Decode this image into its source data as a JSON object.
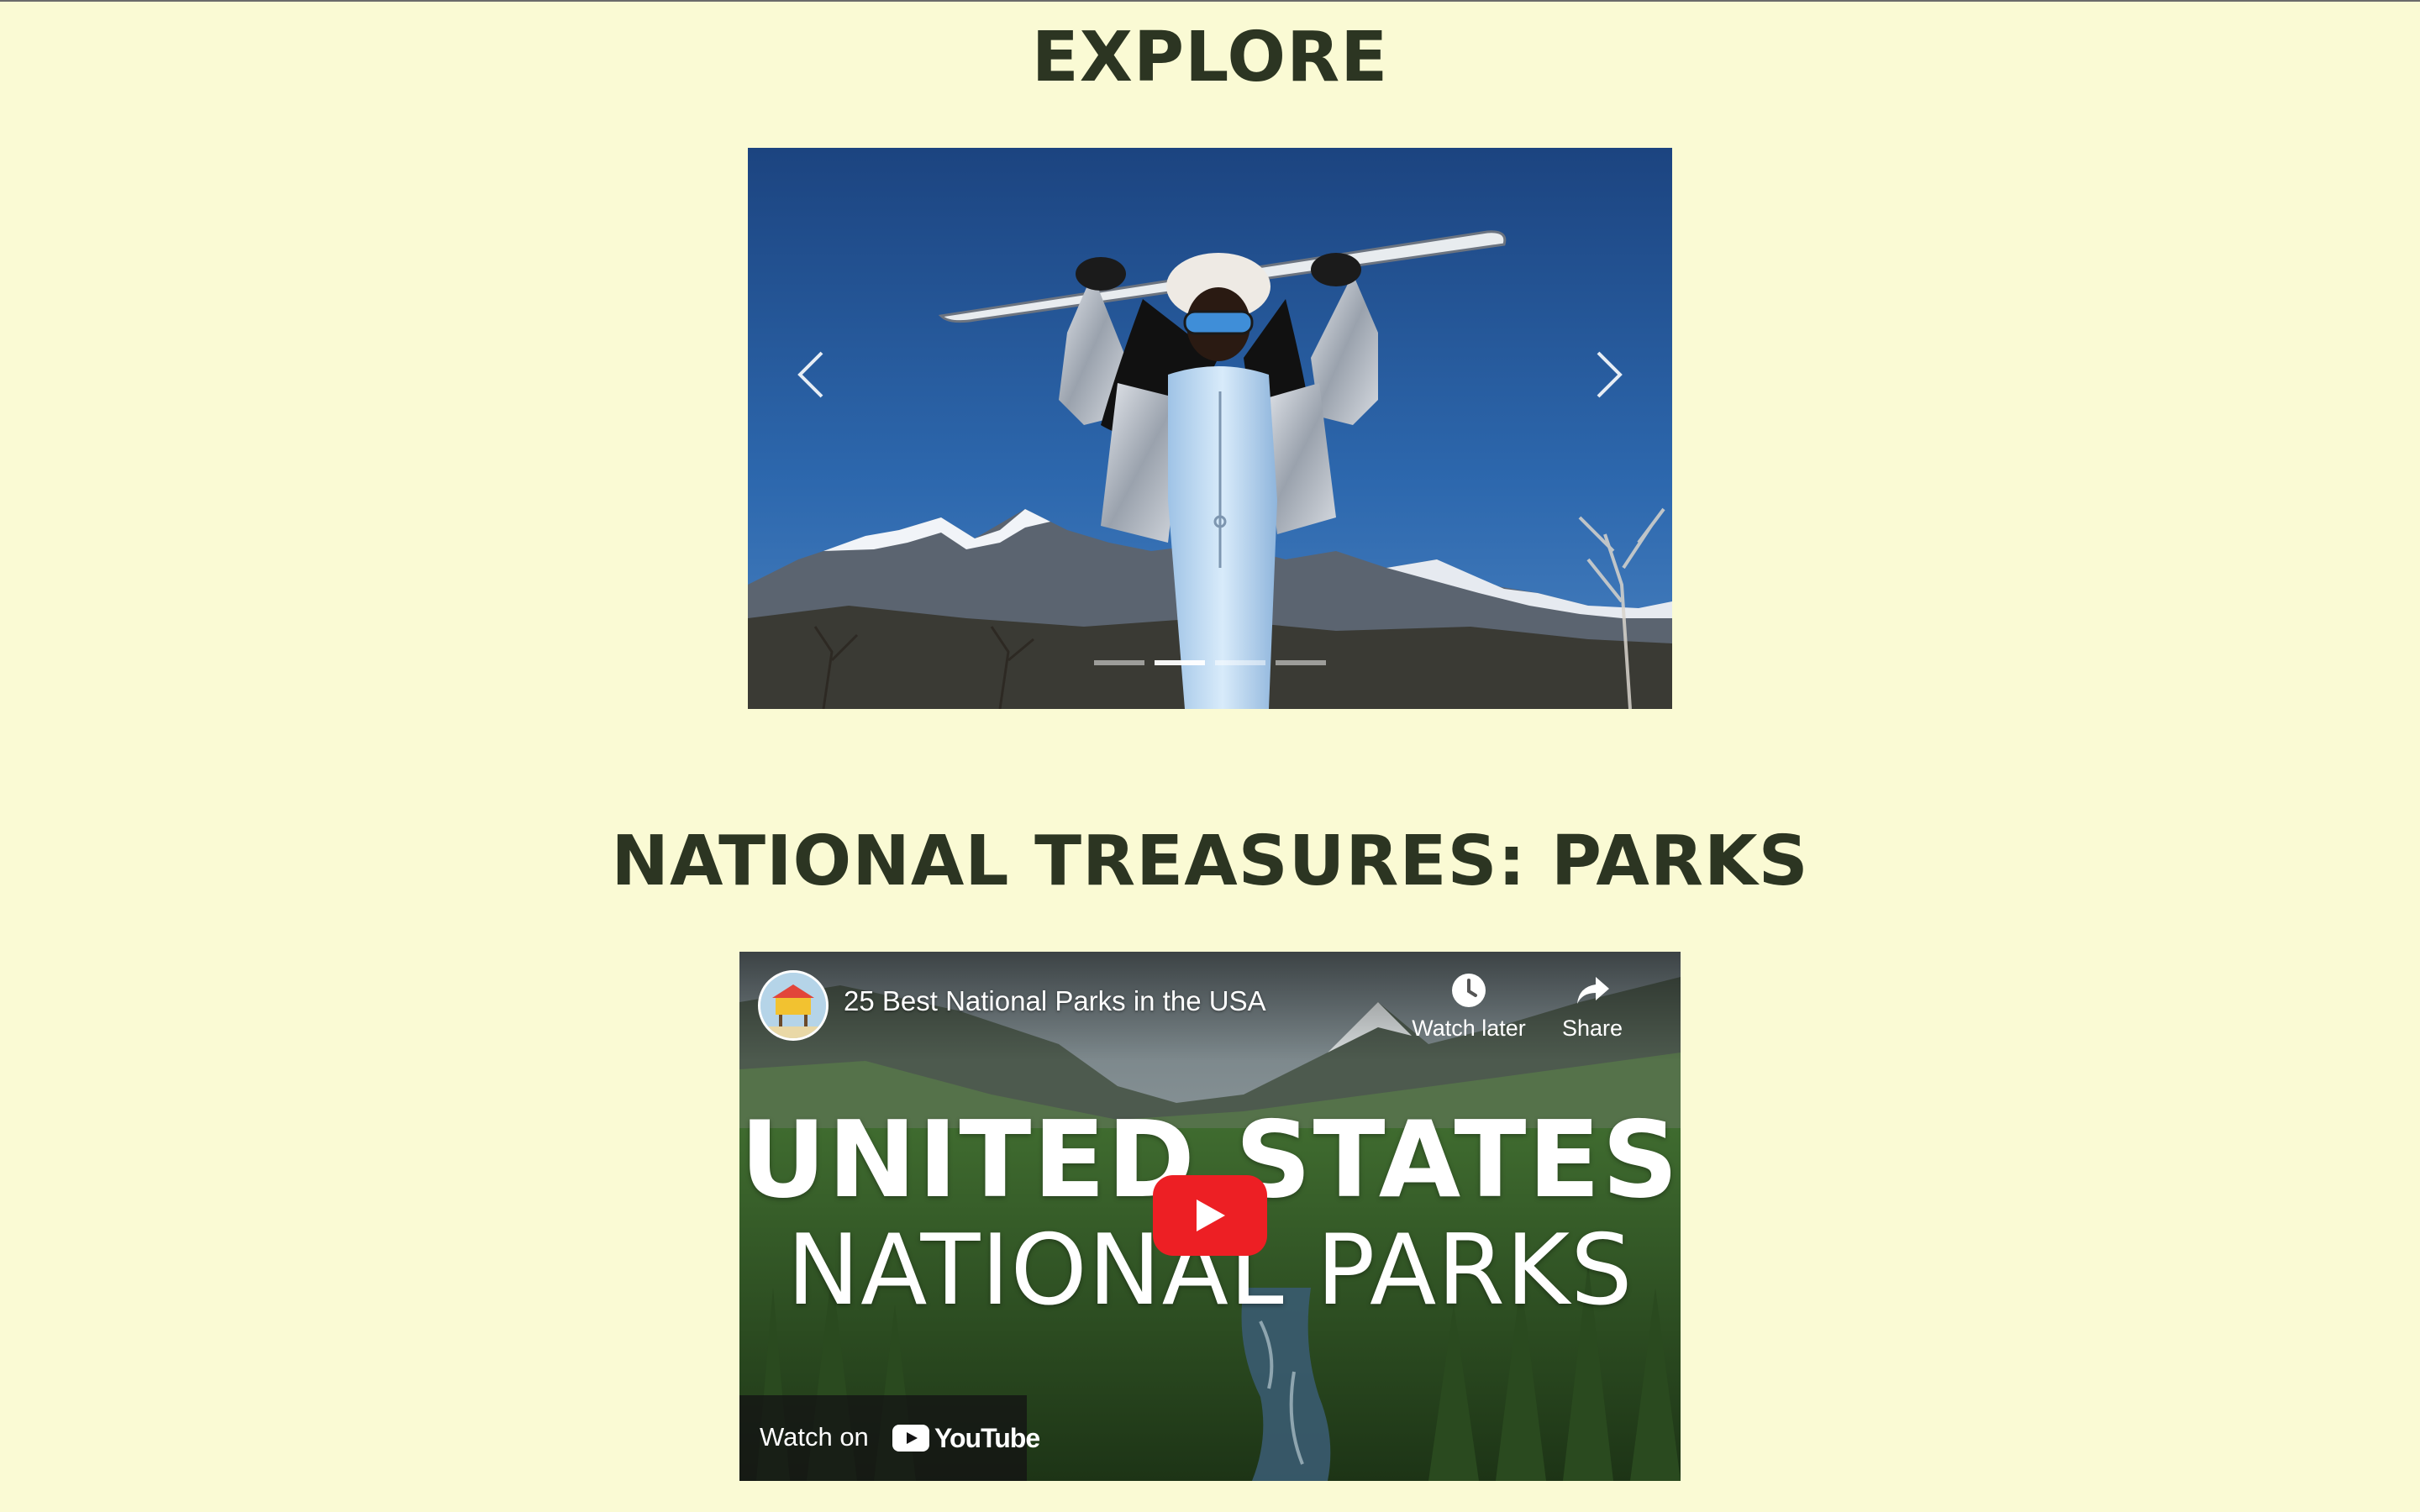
{
  "explore": {
    "title": "EXPLORE",
    "carousel": {
      "slide_count": 4,
      "active_index": 1,
      "prev_icon": "chevron-left-icon",
      "next_icon": "chevron-right-icon"
    }
  },
  "parks": {
    "title": "NATIONAL TREASURES: PARKS",
    "video": {
      "title": "25 Best National Parks in the USA",
      "watch_later_label": "Watch later",
      "share_label": "Share",
      "overlay_line1": "UNITED STATES",
      "overlay_line2": "NATIONAL PARKS",
      "watch_on_label": "Watch on",
      "brand_label": "YouTube"
    }
  },
  "colors": {
    "page_background": "#fafad4",
    "heading_text": "#2c3522",
    "play_button_red": "#ed1f24"
  }
}
